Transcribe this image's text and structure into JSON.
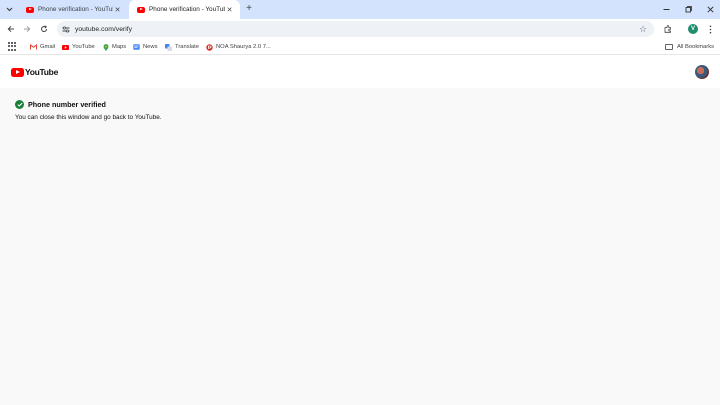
{
  "browser": {
    "tabs": [
      {
        "title": "Phone verification - YouTube",
        "active": false
      },
      {
        "title": "Phone verification - YouTube",
        "active": true
      }
    ],
    "new_tab_glyph": "+",
    "url": "youtube.com/verify",
    "profile_initial": "V",
    "icons": {
      "tab_search": "chevron-down-icon",
      "back": "back-arrow-icon",
      "forward": "forward-arrow-icon",
      "reload": "reload-icon",
      "site_info": "tune-icon",
      "bookmark_star": "star-icon",
      "extensions": "puzzle-icon",
      "menu": "kebab-menu-icon"
    }
  },
  "bookmarks": {
    "items": [
      {
        "label": "Gmail",
        "icon": "gmail-icon",
        "color": "#ea4335"
      },
      {
        "label": "YouTube",
        "icon": "youtube-icon",
        "color": "#ff0000"
      },
      {
        "label": "Maps",
        "icon": "maps-pin-icon",
        "color": "#34a853"
      },
      {
        "label": "News",
        "icon": "news-icon",
        "color": "#4285f4"
      },
      {
        "label": "Translate",
        "icon": "translate-icon",
        "color": "#4285f4"
      },
      {
        "label": "NOA Shaurya 2.0 7...",
        "icon": "noa-icon",
        "color": "#d93025"
      }
    ],
    "all_bookmarks": "All Bookmarks"
  },
  "youtube": {
    "logo_text": "YouTube",
    "brand_color": "#ff0000"
  },
  "verification": {
    "title": "Phone number verified",
    "message": "You can close this window and go back to YouTube.",
    "status_color": "#188038"
  }
}
